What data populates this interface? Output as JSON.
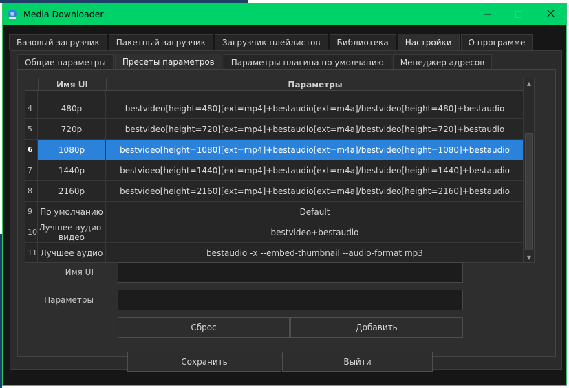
{
  "window": {
    "title": "Media Downloader"
  },
  "tabs_top": [
    "Базовый загрузчик",
    "Пакетный загрузчик",
    "Загрузчик плейлистов",
    "Библиотека",
    "Настройки",
    "О программе"
  ],
  "tabs_top_active": 4,
  "tabs_inner": [
    "Общие параметры",
    "Пресеты параметров",
    "Параметры плагина по умолчанию",
    "Менеджер адресов"
  ],
  "tabs_inner_active": 1,
  "table": {
    "headers": {
      "name": "Имя UI",
      "params": "Параметры"
    },
    "rows": [
      {
        "index": "4",
        "name": "480p",
        "params": "bestvideo[height=480][ext=mp4]+bestaudio[ext=m4a]/bestvideo[height=480]+bestaudio"
      },
      {
        "index": "5",
        "name": "720p",
        "params": "bestvideo[height=720][ext=mp4]+bestaudio[ext=m4a]/bestvideo[height=720]+bestaudio"
      },
      {
        "index": "6",
        "name": "1080p",
        "params": "bestvideo[height=1080][ext=mp4]+bestaudio[ext=m4a]/bestvideo[height=1080]+bestaudio",
        "selected": true
      },
      {
        "index": "7",
        "name": "1440p",
        "params": "bestvideo[height=1440][ext=mp4]+bestaudio[ext=m4a]/bestvideo[height=1440]+bestaudio"
      },
      {
        "index": "8",
        "name": "2160p",
        "params": "bestvideo[height=2160][ext=mp4]+bestaudio[ext=m4a]/bestvideo[height=2160]+bestaudio"
      },
      {
        "index": "9",
        "name": "По умолчанию",
        "params": "Default"
      },
      {
        "index": "10",
        "name": "Лучшее аудио-видео",
        "params": "bestvideo+bestaudio"
      },
      {
        "index": "11",
        "name": "Лучшее аудио",
        "params": "bestaudio -x --embed-thumbnail --audio-format mp3"
      }
    ]
  },
  "form": {
    "name_label": "Имя UI",
    "name_value": "",
    "params_label": "Параметры",
    "params_value": "",
    "reset_label": "Сброс",
    "add_label": "Добавить"
  },
  "footer": {
    "save_label": "Сохранить",
    "exit_label": "Выйти"
  },
  "colors": {
    "titlebar": "#00d26a",
    "selection": "#2a82da",
    "background": "#2b2b2b"
  }
}
